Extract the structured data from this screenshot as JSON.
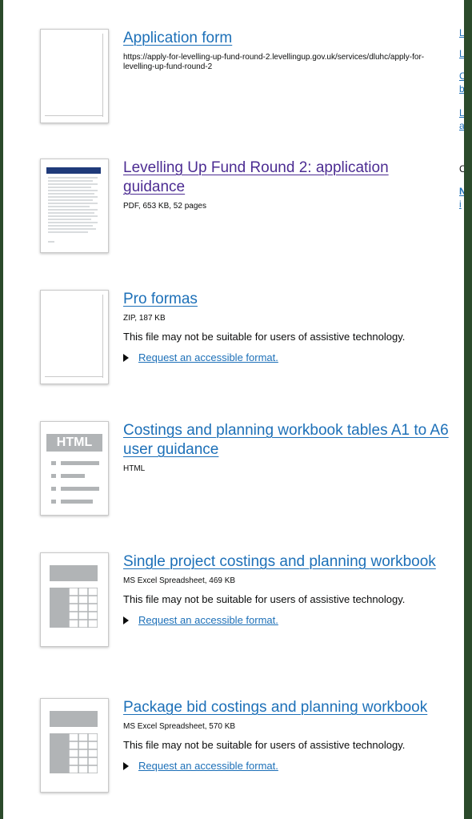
{
  "attachments": [
    {
      "title": "Application form",
      "detail": "https://apply-for-levelling-up-fund-round-2.levellingup.gov.uk/services/dluhc/apply-for-levelling-up-fund-round-2",
      "thumb_type": "blank",
      "visited": false
    },
    {
      "title": "Levelling Up Fund Round 2: application guidance",
      "detail": "PDF, 653 KB, 52 pages",
      "thumb_type": "pdf",
      "visited": true
    },
    {
      "title": "Pro formas",
      "detail": "ZIP, 187 KB",
      "warning": "This file may not be suitable for users of assistive technology.",
      "request": "Request an accessible format.",
      "thumb_type": "blank",
      "visited": false
    },
    {
      "title": "Costings and planning workbook tables A1 to A6 user guidance",
      "detail": "HTML",
      "thumb_type": "html",
      "badge": "HTML",
      "visited": false
    },
    {
      "title": "Single project costings and planning workbook",
      "detail": "MS Excel Spreadsheet, 469 KB",
      "warning": "This file may not be suitable for users of assistive technology.",
      "request": "Request an accessible format.",
      "thumb_type": "spreadsheet",
      "visited": false
    },
    {
      "title": "Package bid costings and planning workbook",
      "detail": "MS Excel Spreadsheet, 570 KB",
      "warning": "This file may not be suitable for users of assistive technology.",
      "request": "Request an accessible format.",
      "thumb_type": "spreadsheet",
      "visited": false
    }
  ],
  "right_column": {
    "fragments": [
      "L",
      "L",
      "C",
      "b",
      "L",
      "a",
      "C",
      "N",
      "i"
    ]
  },
  "colors": {
    "link": "#1d70b8",
    "visited": "#4c2c92",
    "text": "#0b0c0c",
    "thumb_grey": "#b1b4b6",
    "background": "#2b4a2b"
  }
}
